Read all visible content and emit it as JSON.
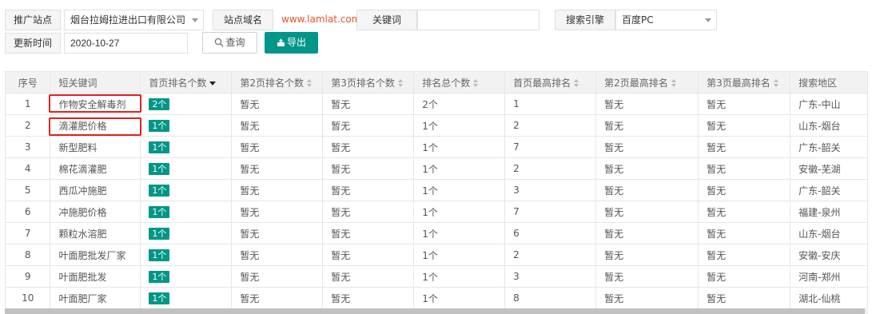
{
  "filters": {
    "site_label": "推广站点",
    "site_value": "烟台拉姆拉进出口有限公司",
    "domain_label": "站点域名",
    "domain_value": "www.lamlat.com",
    "keyword_label": "关键词",
    "keyword_value": "",
    "engine_label": "搜索引擎",
    "engine_value": "百度PC",
    "date_label": "更新时间",
    "date_value": "2020-10-27",
    "query_label": "查询",
    "export_label": "导出"
  },
  "colors": {
    "accent": "#009688",
    "highlight": "#e02020",
    "header_bg": "#f2f2f2"
  },
  "table": {
    "headers": [
      "序号",
      "短关键词",
      "首页排名个数",
      "第2页排名个数",
      "第3页排名个数",
      "排名总个数",
      "首页最高排名",
      "第2页最高排名",
      "第3页最高排名",
      "搜索地区"
    ],
    "rows": [
      [
        "1",
        "作物安全解毒剂",
        "2个",
        "暂无",
        "暂无",
        "2个",
        "1",
        "暂无",
        "暂无",
        "广东-中山"
      ],
      [
        "2",
        "滴灌肥价格",
        "1个",
        "暂无",
        "暂无",
        "1个",
        "2",
        "暂无",
        "暂无",
        "山东-烟台"
      ],
      [
        "3",
        "新型肥料",
        "1个",
        "暂无",
        "暂无",
        "1个",
        "7",
        "暂无",
        "暂无",
        "广东-韶关"
      ],
      [
        "4",
        "棉花滴灌肥",
        "1个",
        "暂无",
        "暂无",
        "1个",
        "2",
        "暂无",
        "暂无",
        "安徽-芜湖"
      ],
      [
        "5",
        "西瓜冲施肥",
        "1个",
        "暂无",
        "暂无",
        "1个",
        "3",
        "暂无",
        "暂无",
        "广东-韶关"
      ],
      [
        "6",
        "冲施肥价格",
        "1个",
        "暂无",
        "暂无",
        "1个",
        "7",
        "暂无",
        "暂无",
        "福建-泉州"
      ],
      [
        "7",
        "颗粒水溶肥",
        "1个",
        "暂无",
        "暂无",
        "1个",
        "6",
        "暂无",
        "暂无",
        "山东-烟台"
      ],
      [
        "8",
        "叶面肥批发厂家",
        "1个",
        "暂无",
        "暂无",
        "1个",
        "2",
        "暂无",
        "暂无",
        "安徽-安庆"
      ],
      [
        "9",
        "叶面肥批发",
        "1个",
        "暂无",
        "暂无",
        "1个",
        "3",
        "暂无",
        "暂无",
        "河南-郑州"
      ],
      [
        "10",
        "叶面肥厂家",
        "1个",
        "暂无",
        "暂无",
        "1个",
        "8",
        "暂无",
        "暂无",
        "湖北-仙桃"
      ]
    ]
  }
}
